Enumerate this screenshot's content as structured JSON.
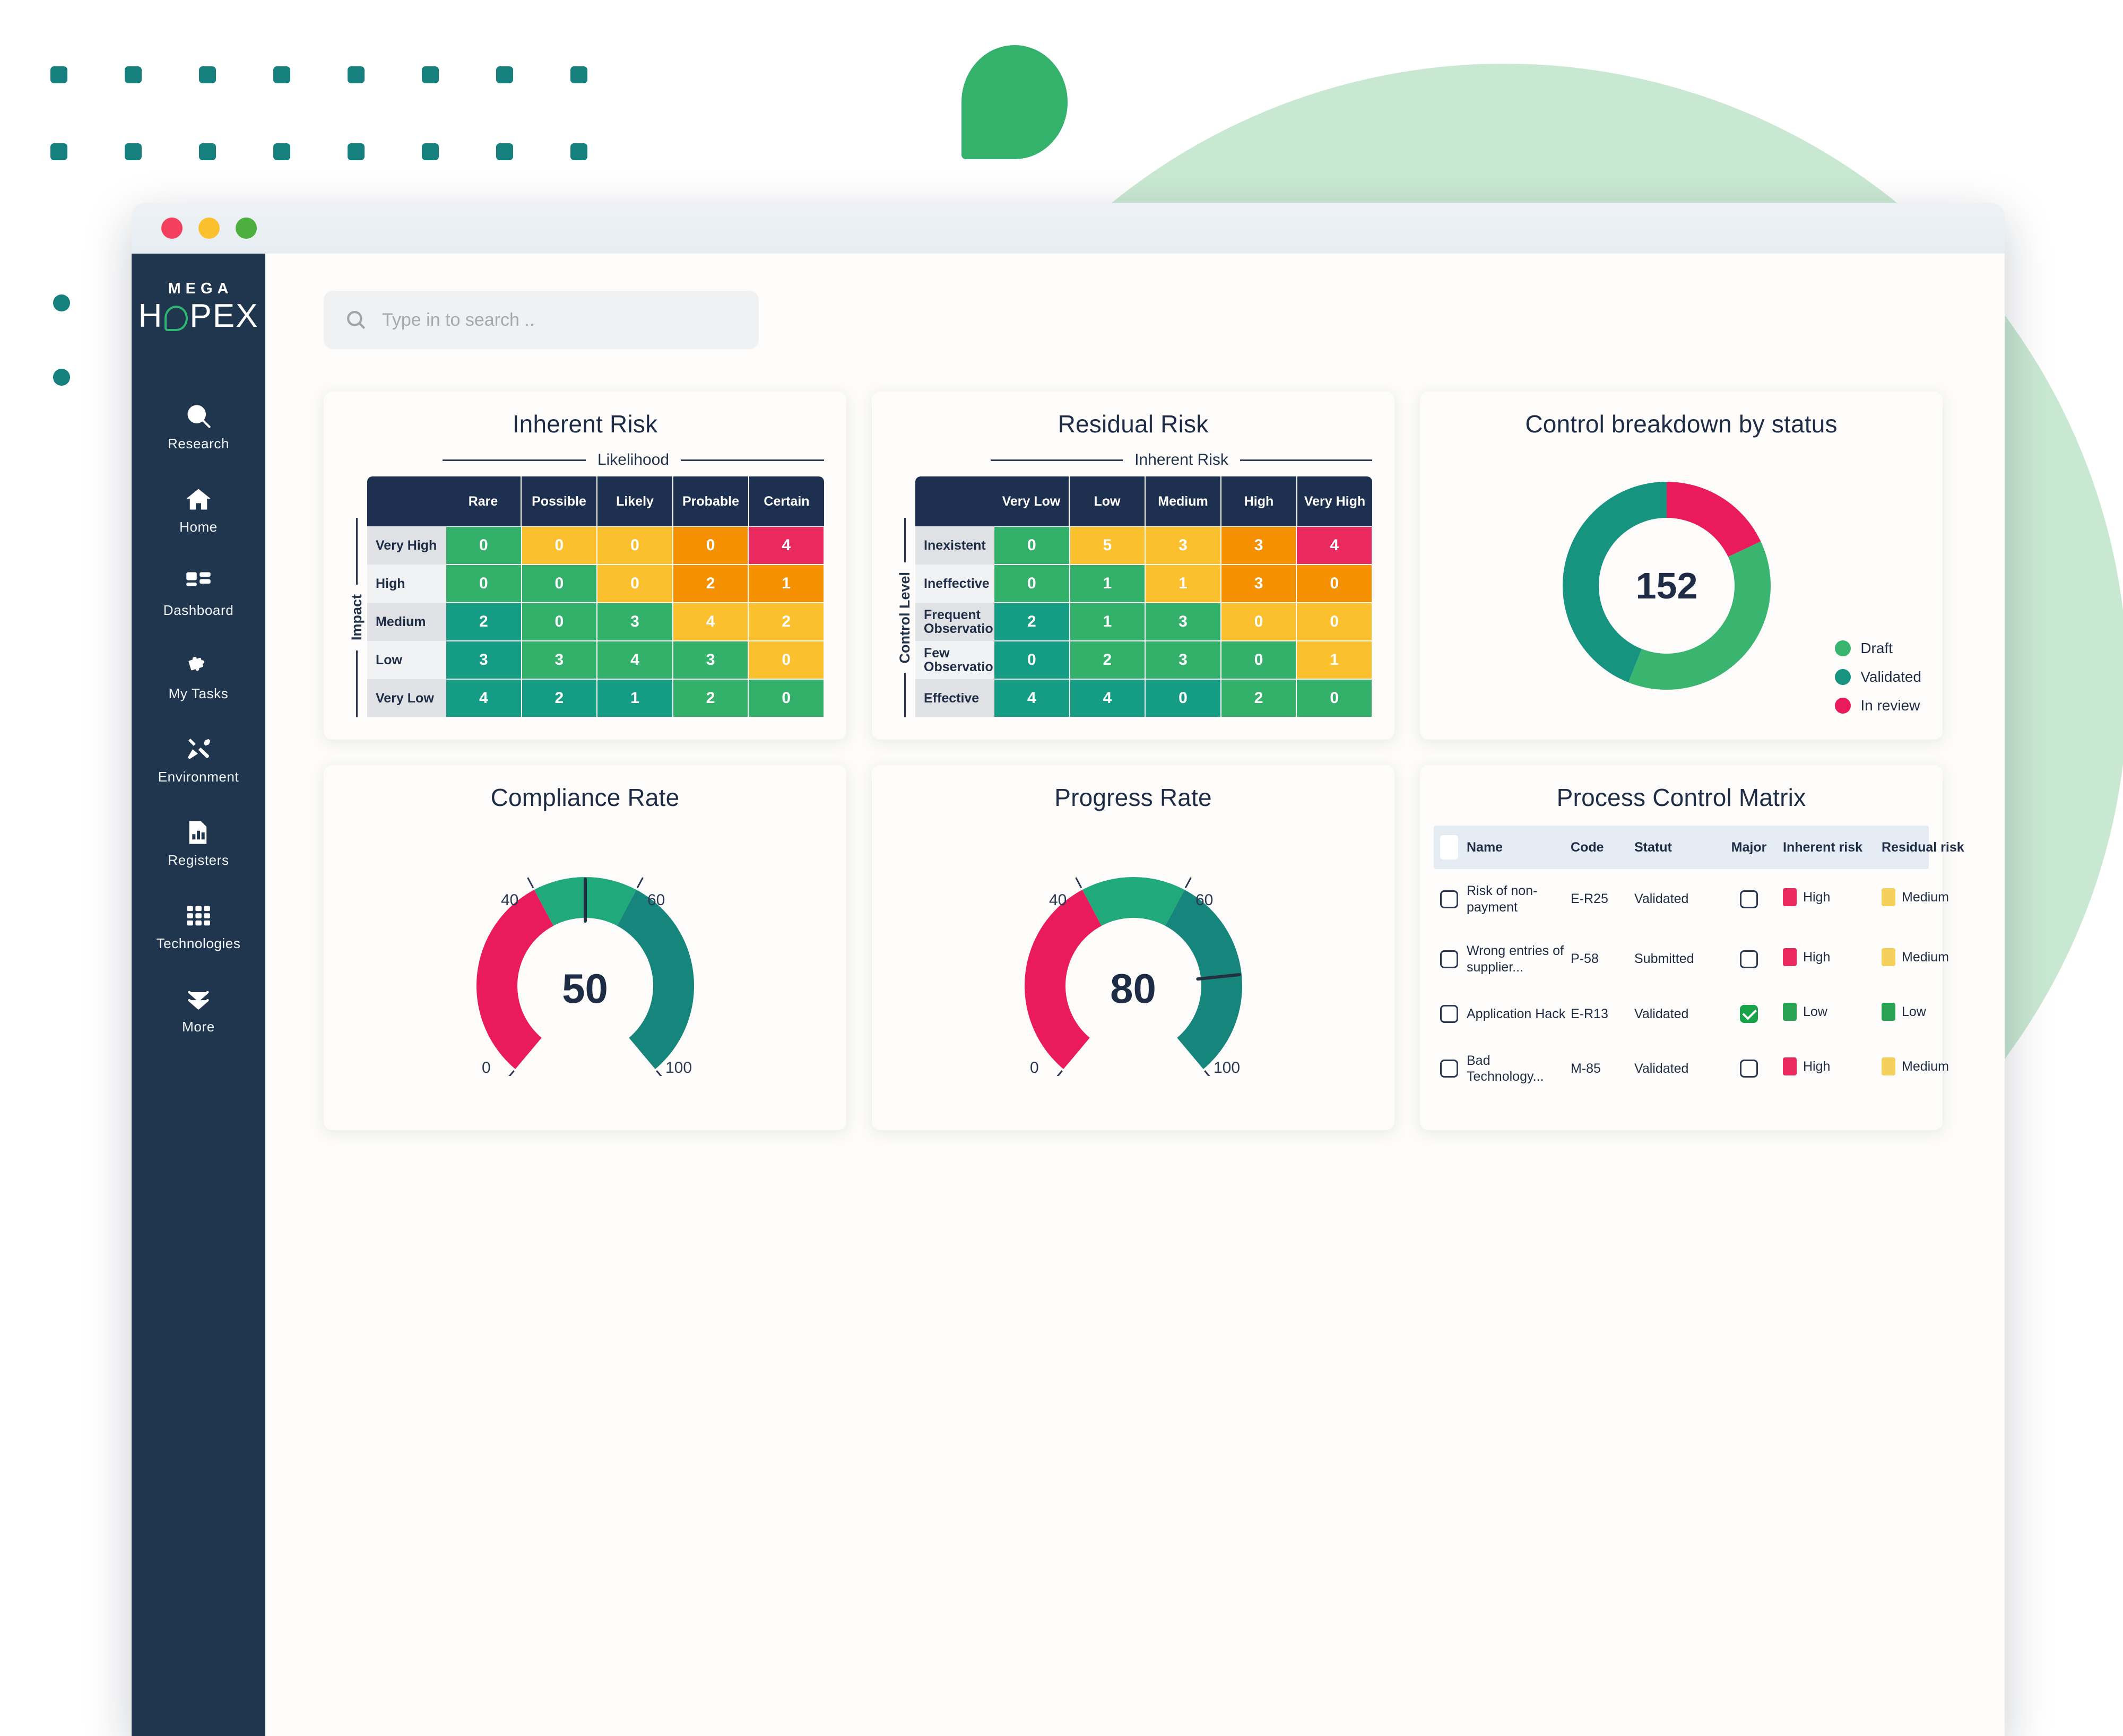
{
  "window": {
    "traffic_lights": [
      "close",
      "minimize",
      "maximize"
    ]
  },
  "sidebar": {
    "logo_top": "MEGA",
    "logo_bottom_a": "H",
    "logo_bottom_b": "PEX",
    "items": [
      {
        "label": "Research",
        "icon": "search-icon"
      },
      {
        "label": "Home",
        "icon": "home-icon"
      },
      {
        "label": "Dashboard",
        "icon": "dashboard-icon"
      },
      {
        "label": "My Tasks",
        "icon": "puzzle-icon"
      },
      {
        "label": "Environment",
        "icon": "tools-icon"
      },
      {
        "label": "Registers",
        "icon": "report-icon"
      },
      {
        "label": "Technologies",
        "icon": "grid-icon"
      },
      {
        "label": "More",
        "icon": "chevron-double-down-icon"
      }
    ]
  },
  "search": {
    "placeholder": "Type in to search ..",
    "value": "",
    "icon": "search-icon"
  },
  "chart_data": [
    {
      "type": "heatmap",
      "title": "Inherent Risk",
      "xlabel": "Likelihood",
      "ylabel": "Impact",
      "categories": [
        "Rare",
        "Possible",
        "Likely",
        "Probable",
        "Certain"
      ],
      "rows": [
        "Very High",
        "High",
        "Medium",
        "Low",
        "Very Low"
      ],
      "values": [
        [
          0,
          0,
          0,
          0,
          4
        ],
        [
          0,
          0,
          0,
          2,
          1
        ],
        [
          2,
          0,
          3,
          4,
          2
        ],
        [
          3,
          3,
          4,
          3,
          0
        ],
        [
          4,
          2,
          1,
          2,
          0
        ]
      ],
      "cell_colors": [
        [
          "c-green",
          "c-yellow",
          "c-yellow",
          "c-orange",
          "c-pink"
        ],
        [
          "c-green",
          "c-green",
          "c-yellow",
          "c-orange",
          "c-orange"
        ],
        [
          "c-teal",
          "c-green",
          "c-green",
          "c-yellow",
          "c-yellow"
        ],
        [
          "c-teal",
          "c-green",
          "c-green",
          "c-green",
          "c-yellow"
        ],
        [
          "c-teal",
          "c-teal",
          "c-teal",
          "c-green",
          "c-green"
        ]
      ]
    },
    {
      "type": "heatmap",
      "title": "Residual Risk",
      "xlabel": "Inherent Risk",
      "ylabel": "Control Level",
      "categories": [
        "Very Low",
        "Low",
        "Medium",
        "High",
        "Very High"
      ],
      "rows": [
        "Inexistent",
        "Ineffective",
        "Frequent Observation",
        "Few Observations",
        "Effective"
      ],
      "values": [
        [
          0,
          5,
          3,
          3,
          4
        ],
        [
          0,
          1,
          1,
          3,
          0
        ],
        [
          2,
          1,
          3,
          0,
          0
        ],
        [
          0,
          2,
          3,
          0,
          1
        ],
        [
          4,
          4,
          0,
          2,
          0
        ]
      ],
      "cell_colors": [
        [
          "c-green",
          "c-yellow",
          "c-yellow",
          "c-orange",
          "c-pink"
        ],
        [
          "c-green",
          "c-green",
          "c-yellow",
          "c-orange",
          "c-orange"
        ],
        [
          "c-teal",
          "c-green",
          "c-green",
          "c-yellow",
          "c-yellow"
        ],
        [
          "c-teal",
          "c-green",
          "c-green",
          "c-green",
          "c-yellow"
        ],
        [
          "c-teal",
          "c-teal",
          "c-teal",
          "c-green",
          "c-green"
        ]
      ]
    },
    {
      "type": "pie",
      "title": "Control breakdown by status",
      "center_value": "152",
      "labels": [
        "Draft",
        "Validated",
        "In review"
      ],
      "values": [
        38,
        44,
        18
      ],
      "colors": [
        "#3AB570",
        "#169480",
        "#EA1B5C"
      ],
      "legend_position": "bottom-right"
    },
    {
      "type": "gauge",
      "title": "Compliance Rate",
      "value": 50,
      "ylim": [
        0,
        100
      ],
      "tick_labels": [
        "0",
        "40",
        "60",
        "100"
      ],
      "bands": [
        {
          "from": 0,
          "to": 40,
          "color": "#EA1B5C"
        },
        {
          "from": 40,
          "to": 60,
          "color": "#20A97A"
        },
        {
          "from": 60,
          "to": 100,
          "color": "#16867C"
        }
      ]
    },
    {
      "type": "gauge",
      "title": "Progress Rate",
      "value": 80,
      "ylim": [
        0,
        100
      ],
      "tick_labels": [
        "0",
        "40",
        "60",
        "100"
      ],
      "bands": [
        {
          "from": 0,
          "to": 40,
          "color": "#EA1B5C"
        },
        {
          "from": 40,
          "to": 60,
          "color": "#20A97A"
        },
        {
          "from": 60,
          "to": 100,
          "color": "#16867C"
        }
      ]
    }
  ],
  "process_control_matrix": {
    "title": "Process Control Matrix",
    "columns": [
      "Name",
      "Code",
      "Statut",
      "Major",
      "Inherent risk",
      "Residual risk"
    ],
    "rows": [
      {
        "selected": false,
        "name": "Risk of non-payment",
        "code": "E-R25",
        "statut": "Validated",
        "major": false,
        "inherent_risk": "High",
        "inherent_class": "sq-high",
        "residual_risk": "Medium",
        "residual_class": "sq-med"
      },
      {
        "selected": false,
        "name": "Wrong entries of supplier...",
        "code": "P-58",
        "statut": "Submitted",
        "major": false,
        "inherent_risk": "High",
        "inherent_class": "sq-high",
        "residual_risk": "Medium",
        "residual_class": "sq-med"
      },
      {
        "selected": false,
        "name": "Application Hack",
        "code": "E-R13",
        "statut": "Validated",
        "major": true,
        "inherent_risk": "Low",
        "inherent_class": "sq-low",
        "residual_risk": "Low",
        "residual_class": "sq-low"
      },
      {
        "selected": false,
        "name": "Bad Technology...",
        "code": "M-85",
        "statut": "Validated",
        "major": false,
        "inherent_risk": "High",
        "inherent_class": "sq-high",
        "residual_risk": "Medium",
        "residual_class": "sq-med"
      }
    ]
  }
}
